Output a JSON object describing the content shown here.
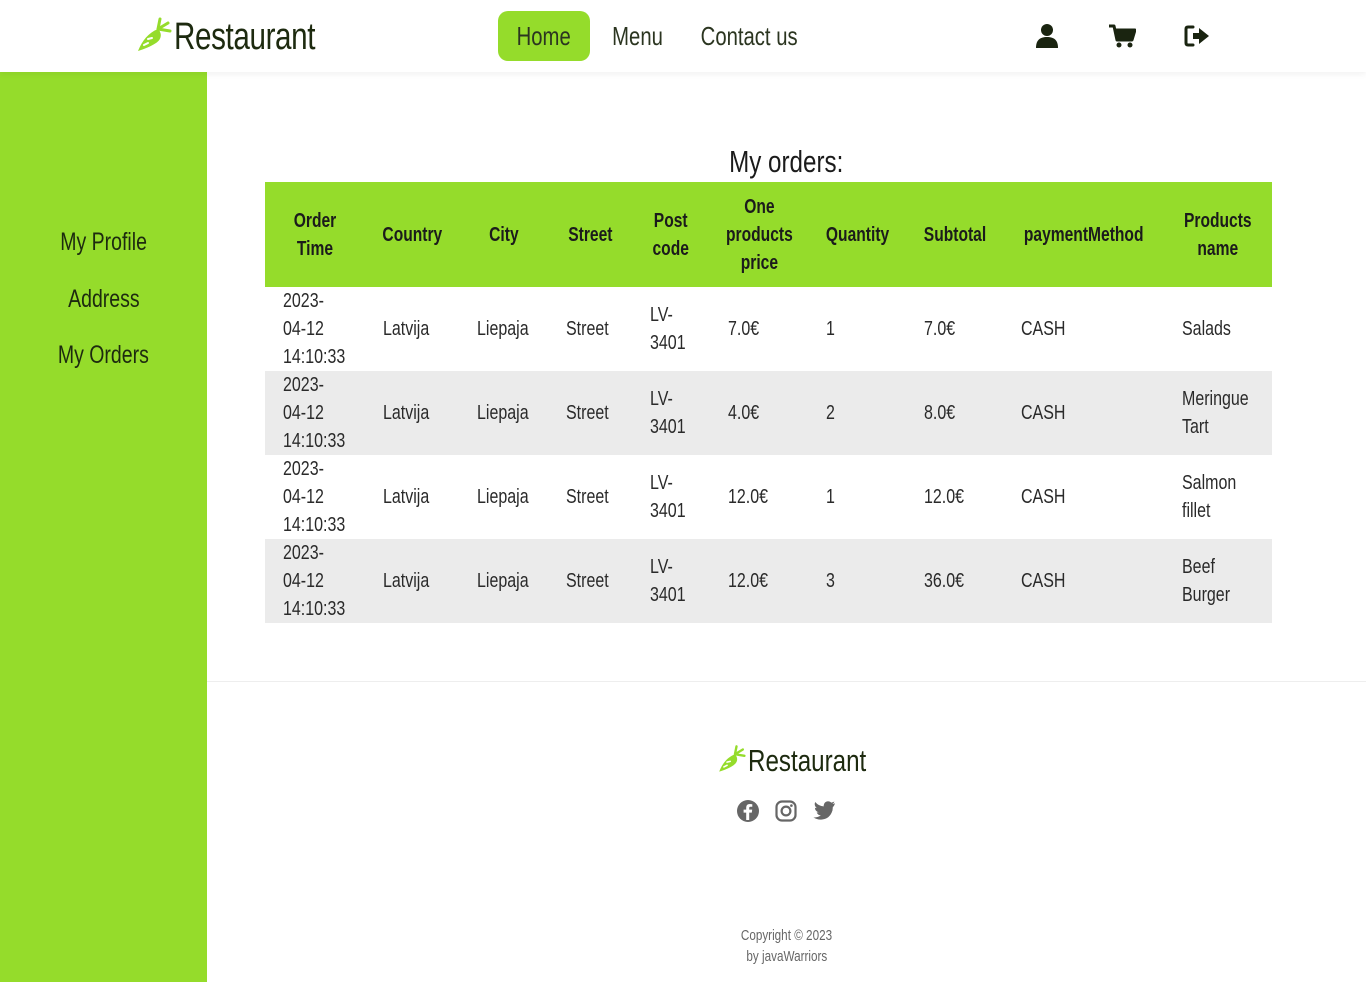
{
  "brand": {
    "name": "Restaurant",
    "accent": "#95dc2b",
    "icon": "carrot-icon"
  },
  "nav": {
    "home": "Home",
    "menu": "Menu",
    "contact": "Contact us"
  },
  "header_icons": [
    "user-icon",
    "cart-icon",
    "logout-icon"
  ],
  "sidebar": {
    "items": [
      {
        "label": "My Profile"
      },
      {
        "label": "Address"
      },
      {
        "label": "My Orders"
      }
    ]
  },
  "orders": {
    "title": "My orders:",
    "columns": [
      "Order Time",
      "Country",
      "City",
      "Street",
      "Post code",
      "One products price",
      "Quantity",
      "Subtotal",
      "paymentMethod",
      "Products name"
    ],
    "rows": [
      {
        "time": "2023-04-12 14:10:33",
        "country": "Latvija",
        "city": "Liepaja",
        "street": "Street",
        "post": "LV-3401",
        "price": "7.0€",
        "qty": "1",
        "subtotal": "7.0€",
        "payment": "CASH",
        "product": "Salads"
      },
      {
        "time": "2023-04-12 14:10:33",
        "country": "Latvija",
        "city": "Liepaja",
        "street": "Street",
        "post": "LV-3401",
        "price": "4.0€",
        "qty": "2",
        "subtotal": "8.0€",
        "payment": "CASH",
        "product": "Meringue Tart"
      },
      {
        "time": "2023-04-12 14:10:33",
        "country": "Latvija",
        "city": "Liepaja",
        "street": "Street",
        "post": "LV-3401",
        "price": "12.0€",
        "qty": "1",
        "subtotal": "12.0€",
        "payment": "CASH",
        "product": "Salmon fillet"
      },
      {
        "time": "2023-04-12 14:10:33",
        "country": "Latvija",
        "city": "Liepaja",
        "street": "Street",
        "post": "LV-3401",
        "price": "12.0€",
        "qty": "3",
        "subtotal": "36.0€",
        "payment": "CASH",
        "product": "Beef Burger"
      }
    ]
  },
  "footer": {
    "brand": "Restaurant",
    "social": [
      "facebook-icon",
      "instagram-icon",
      "twitter-icon"
    ],
    "copyright": "Copyright © 2023",
    "by": "by javaWarriors"
  }
}
